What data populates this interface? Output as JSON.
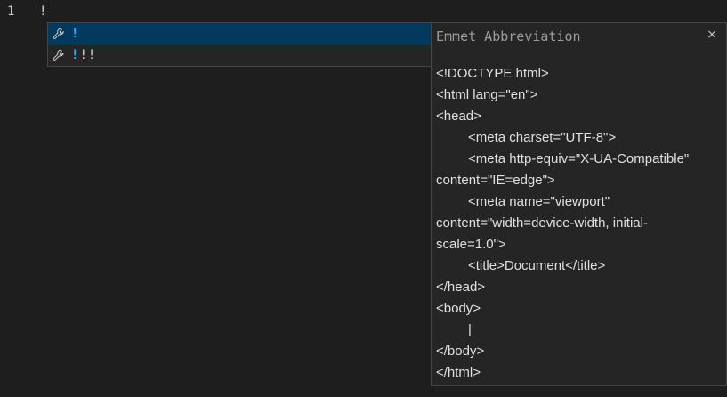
{
  "editor": {
    "line_number": "1",
    "line_text": "!"
  },
  "suggestions": [
    {
      "icon": "wrench-icon",
      "highlight": "!",
      "rest": "",
      "selected": true
    },
    {
      "icon": "wrench-icon",
      "highlight": "!",
      "rest": "!!",
      "selected": false
    }
  ],
  "details": {
    "title": "Emmet Abbreviation",
    "close_label": "×",
    "lines": [
      "<!DOCTYPE html>",
      "<html lang=\"en\">",
      "<head>",
      "<meta charset=\"UTF-8\">",
      "<meta http-equiv=\"X-UA-Compatible\"",
      "content=\"IE=edge\">",
      "<meta name=\"viewport\"",
      "content=\"width=device-width, initial-",
      "scale=1.0\">",
      "<title>Document</title>",
      "</head>",
      "<body>",
      "|",
      "</body>",
      "</html>"
    ]
  }
}
